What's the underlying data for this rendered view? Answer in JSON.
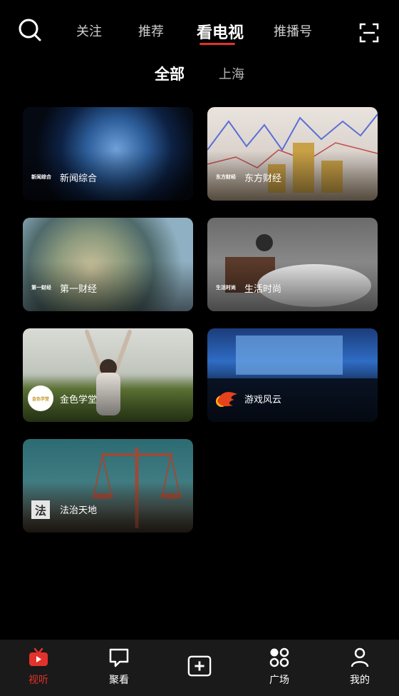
{
  "top_tabs": [
    "关注",
    "推荐",
    "看电视",
    "推播号"
  ],
  "active_top_tab": "看电视",
  "sub_tabs": [
    "全部",
    "上海"
  ],
  "active_sub_tab": "全部",
  "channels": [
    {
      "name": "新闻综合",
      "logo": "新闻综合"
    },
    {
      "name": "东方财经",
      "logo": "东方财经"
    },
    {
      "name": "第一财经",
      "logo": "第一财经"
    },
    {
      "name": "生活时尚",
      "logo": "生活时尚"
    },
    {
      "name": "金色学堂",
      "logo": "金色学堂"
    },
    {
      "name": "游戏风云",
      "logo": ""
    },
    {
      "name": "法治天地",
      "logo": "法"
    }
  ],
  "bottom_nav": [
    "视听",
    "聚看",
    "",
    "广场",
    "我的"
  ],
  "active_nav": "视听",
  "colors": {
    "accent": "#e3322b",
    "background": "#000000",
    "nav_bg": "#1a1a1a"
  },
  "icons": {
    "search": "search-icon",
    "scan": "scan-icon",
    "nav": [
      "tv-icon",
      "chat-bubble-icon",
      "add-icon",
      "grid-dots-icon",
      "user-icon"
    ]
  }
}
